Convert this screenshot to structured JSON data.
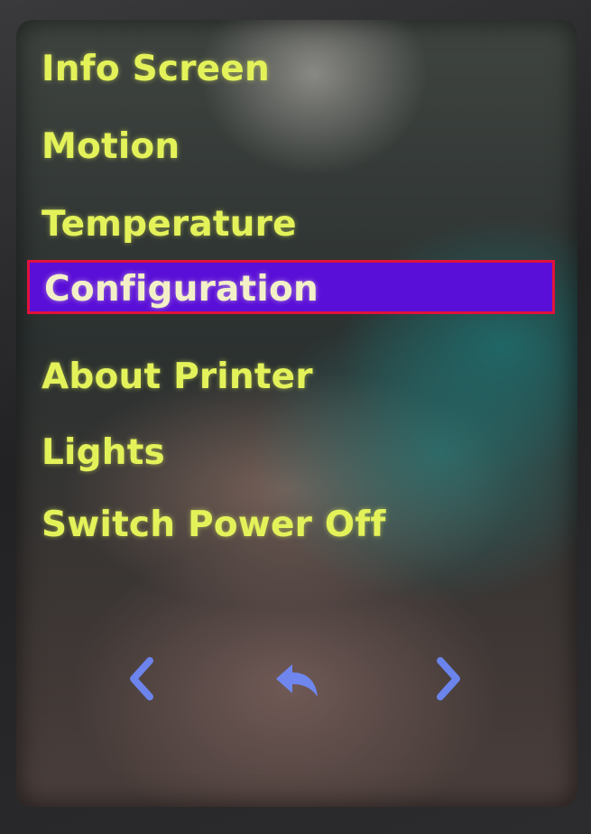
{
  "menu": {
    "items": [
      {
        "label": "Info Screen",
        "selected": false
      },
      {
        "label": "Motion",
        "selected": false
      },
      {
        "label": "Temperature",
        "selected": false
      },
      {
        "label": "Configuration",
        "selected": true
      },
      {
        "label": "About Printer",
        "selected": false
      },
      {
        "label": "Lights",
        "selected": false
      },
      {
        "label": "Switch Power Off",
        "selected": false
      }
    ]
  },
  "nav": {
    "prev_icon": "chevron-left-icon",
    "back_icon": "back-arrow-icon",
    "next_icon": "chevron-right-icon"
  },
  "colors": {
    "menu_text": "#e4f25a",
    "selected_background": "#5a0fd8",
    "selected_border": "#e0123c",
    "nav_icons": "#6f8cff"
  }
}
